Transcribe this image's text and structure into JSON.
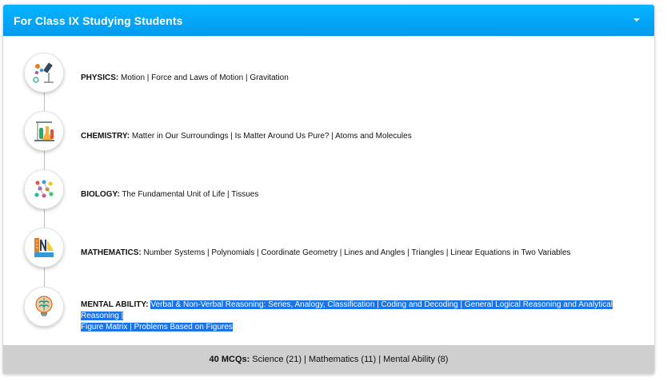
{
  "header": {
    "title": "For Class IX Studying Students"
  },
  "subjects": [
    {
      "name": "PHYSICS:",
      "topics": "Motion | Force and Laws of Motion | Gravitation",
      "icon": "physics-icon"
    },
    {
      "name": "CHEMISTRY:",
      "topics": "Matter in Our Surroundings | Is Matter Around Us Pure? | Atoms and Molecules",
      "icon": "chemistry-icon"
    },
    {
      "name": "BIOLOGY:",
      "topics": "The Fundamental Unit of Life | Tissues",
      "icon": "biology-icon"
    },
    {
      "name": "MATHEMATICS:",
      "topics": "Number Systems | Polynomials | Coordinate Geometry | Lines and Angles | Triangles | Linear Equations in Two Variables",
      "icon": "mathematics-icon"
    },
    {
      "name": "MENTAL ABILITY:",
      "topics_line1": "Verbal & Non-Verbal Reasoning: Series, Analogy, Classification | Coding and Decoding | General Logical Reasoning and Analytical Reasoning |",
      "topics_line2": "Figure Matrix | Problems Based on Figures",
      "icon": "mental-ability-icon"
    }
  ],
  "footer": {
    "label": "40 MCQs:",
    "breakdown": "Science (21) | Mathematics (11) | Mental Ability (8)"
  },
  "colors": {
    "header_bg": "#03a9f4",
    "footer_bg": "#cfcfcf",
    "selection": "#1a73e8"
  }
}
